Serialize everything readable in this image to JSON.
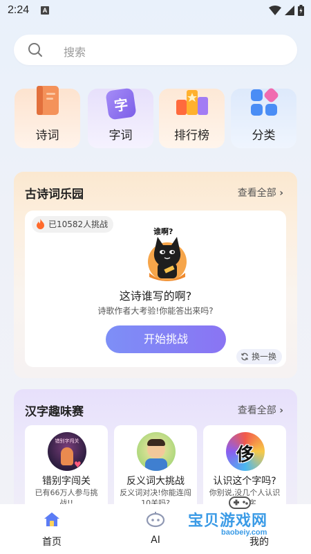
{
  "status_bar": {
    "time": "2:24",
    "notification_letter": "A"
  },
  "search": {
    "placeholder": "搜索"
  },
  "categories": [
    {
      "label": "诗词",
      "icon": "book-icon",
      "color": "#f07f4f"
    },
    {
      "label": "字词",
      "icon": "character-card-icon",
      "glyph": "字",
      "color": "#8e6cf2"
    },
    {
      "label": "排行榜",
      "icon": "podium-icon",
      "color": "#ff6a3d"
    },
    {
      "label": "分类",
      "icon": "grid-category-icon",
      "color": "#4a8df5"
    }
  ],
  "poetry_section": {
    "title": "古诗词乐园",
    "see_all": "查看全部",
    "challenge_badge": "已10582人挑战",
    "mascot_bubble": "谁啊?",
    "question": "这诗谁写的啊?",
    "subtitle": "诗歌作者大考验!你能答出来吗?",
    "start_button": "开始挑战",
    "swap_button": "换一换"
  },
  "hanzi_section": {
    "title": "汉字趣味赛",
    "see_all": "查看全部",
    "games": [
      {
        "title": "错别字闯关",
        "desc": "已有66万人参与挑战!!",
        "thumb_text": "错别字闯关"
      },
      {
        "title": "反义词大挑战",
        "desc": "反义词对决!你能连闯10关吗?"
      },
      {
        "title": "认识这个字吗?",
        "desc": "你别说,没几个人认识这个字",
        "thumb_glyph": "侈"
      }
    ]
  },
  "bottom_nav": [
    {
      "label": "首页",
      "icon": "home-icon",
      "active": true
    },
    {
      "label": "AI",
      "icon": "robot-icon",
      "active": false
    },
    {
      "label": "我的",
      "icon": "profile-icon",
      "active": false
    }
  ],
  "watermark": {
    "text": "宝贝游戏网",
    "url_text": "baobeiy.com"
  },
  "colors": {
    "accent": "#8a74f3",
    "home_icon": "#5b7cf5"
  }
}
